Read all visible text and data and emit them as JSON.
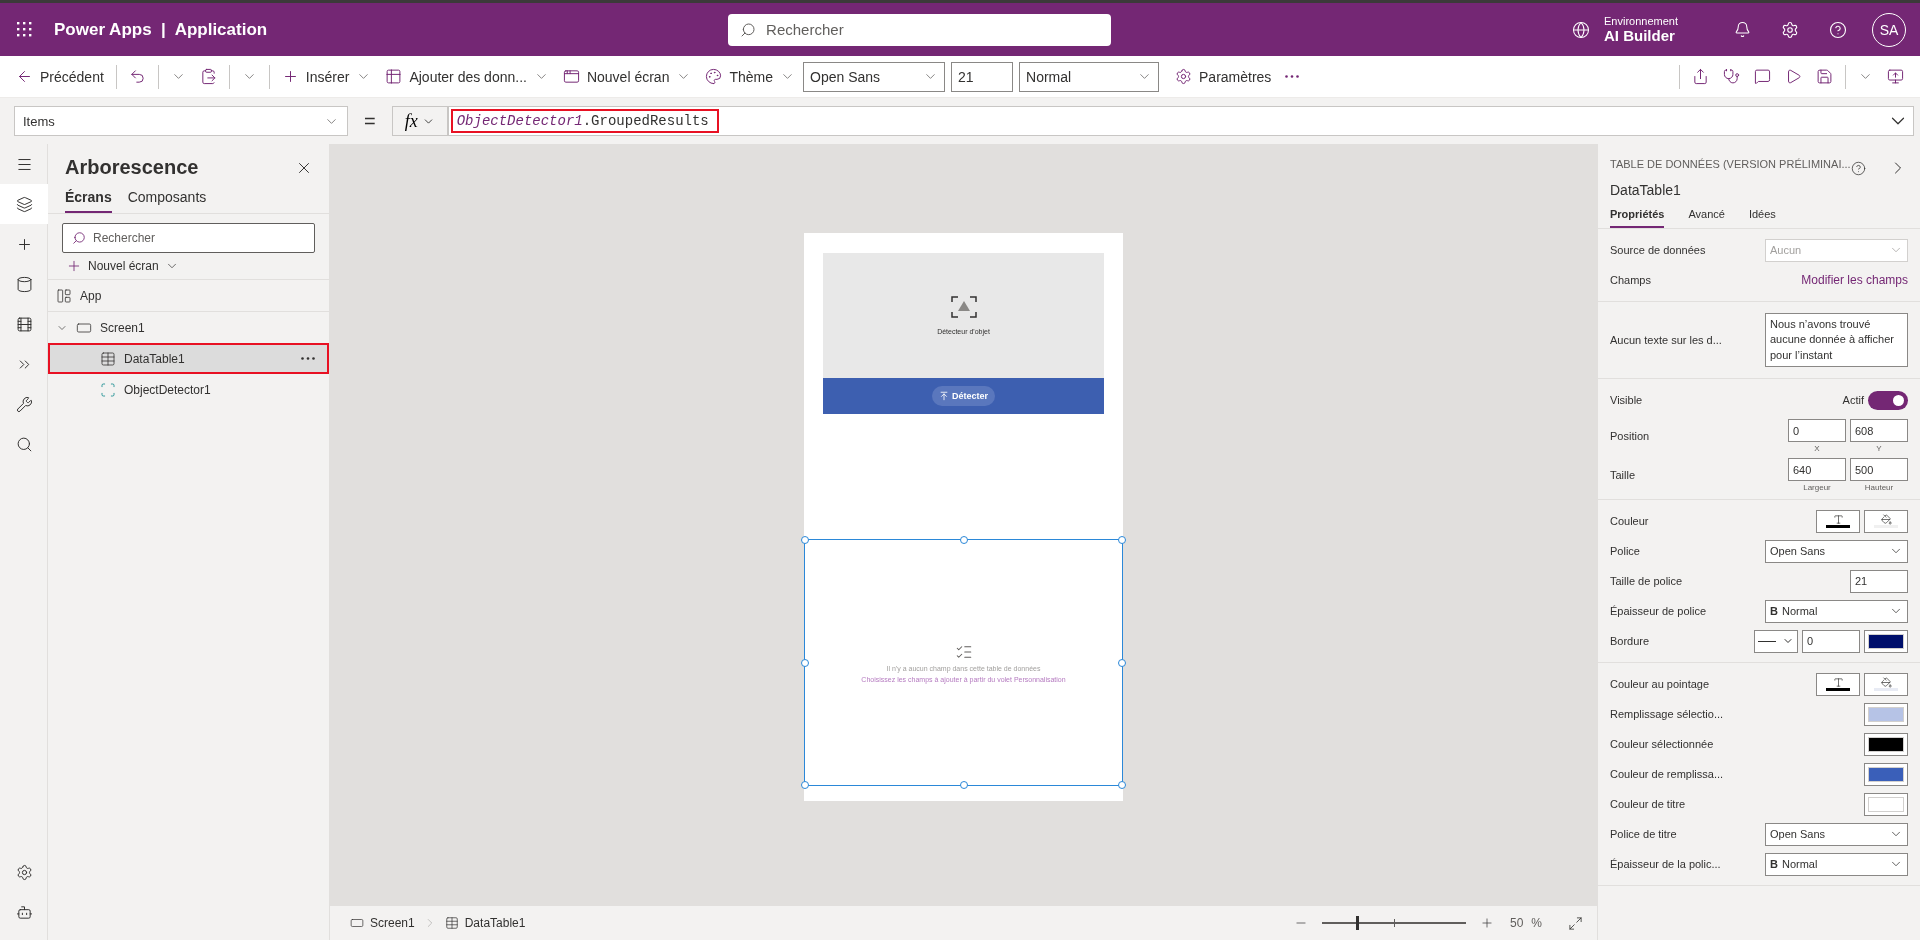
{
  "top_bar": {
    "title": "Power Apps  |  Application",
    "search": {
      "placeholder": "Rechercher"
    },
    "environment": {
      "label": "Environnement",
      "name": "AI Builder"
    },
    "avatar": "SA"
  },
  "toolbar": {
    "back": "Précédent",
    "insert": "Insérer",
    "add_data": "Ajouter des donn...",
    "new_screen": "Nouvel écran",
    "theme": "Thème",
    "font": "Open Sans",
    "font_size": "21",
    "font_weight": "Normal",
    "settings": "Paramètres"
  },
  "formula_bar": {
    "property": "Items",
    "equals": "=",
    "fx": "fx",
    "object": "ObjectDetector1",
    "member": ".GroupedResults",
    "highlighted": true
  },
  "rail": {
    "top": [
      {
        "kind": "menu",
        "selected": false
      },
      {
        "kind": "tree",
        "selected": true
      },
      {
        "kind": "insert",
        "selected": false
      },
      {
        "kind": "data",
        "selected": false
      },
      {
        "kind": "media",
        "selected": false
      },
      {
        "kind": "automate",
        "selected": false
      },
      {
        "kind": "tools",
        "selected": false
      },
      {
        "kind": "search",
        "selected": false
      }
    ],
    "bottom": [
      {
        "kind": "settings",
        "selected": false
      },
      {
        "kind": "bot",
        "selected": false
      }
    ]
  },
  "tree_panel": {
    "title": "Arborescence",
    "tabs": [
      {
        "label": "Écrans",
        "selected": true
      },
      {
        "label": "Composants",
        "selected": false
      }
    ],
    "search": {
      "placeholder": "Rechercher"
    },
    "new_screen": "Nouvel écran",
    "items": [
      {
        "kind": "app",
        "label": "App",
        "selected": false
      },
      {
        "kind": "screen",
        "label": "Screen1",
        "selected": false,
        "expanded": true,
        "children": [
          {
            "kind": "table",
            "label": "DataTable1",
            "selected": true,
            "highlighted": true
          },
          {
            "kind": "detector",
            "label": "ObjectDetector1",
            "selected": false,
            "highlighted": false
          }
        ]
      }
    ]
  },
  "canvas": {
    "detector": {
      "label": "Détecteur d'objet",
      "button": "Détecter"
    },
    "table": {
      "selected": true,
      "message": "Il n'y a aucun champ dans cette table de données",
      "hint": "Choisissez les champs à ajouter à partir du volet Personnalisation"
    }
  },
  "status_bar": {
    "breadcrumbs": [
      {
        "kind": "screen",
        "label": "Screen1"
      },
      {
        "kind": "table",
        "label": "DataTable1"
      }
    ],
    "zoom": {
      "level": 0.24,
      "value": "50",
      "unit": "%"
    }
  },
  "properties": {
    "type": "TABLE DE DONNÉES (VERSION PRÉLIMINAI...",
    "name": "DataTable1",
    "tabs": [
      {
        "label": "Propriétés",
        "selected": true
      },
      {
        "label": "Avancé",
        "selected": false
      },
      {
        "label": "Idées",
        "selected": false
      }
    ],
    "sections": [
      {
        "rows": [
          {
            "kind": "dropdown",
            "label": "Source de données",
            "value": "Aucun",
            "disabled": true
          },
          {
            "kind": "link",
            "label": "Champs",
            "link": "Modifier les champs"
          }
        ]
      },
      {
        "rows": [
          {
            "kind": "textarea",
            "label": "Aucun texte sur les d...",
            "value": "Nous n’avons trouvé aucune donnée à afficher pour l’instant"
          }
        ]
      },
      {
        "rows": [
          {
            "kind": "toggle",
            "label": "Visible",
            "state": "Actif",
            "on": true
          },
          {
            "kind": "pair",
            "label": "Position",
            "fields": [
              {
                "value": "0",
                "caption": "X"
              },
              {
                "value": "608",
                "caption": "Y"
              }
            ]
          },
          {
            "kind": "pair",
            "label": "Taille",
            "fields": [
              {
                "value": "640",
                "caption": "Largeur"
              },
              {
                "value": "500",
                "caption": "Hauteur"
              }
            ]
          }
        ]
      },
      {
        "rows": [
          {
            "kind": "swatches",
            "label": "Couleur",
            "swatches": [
              {
                "kind": "text",
                "color": "#000000"
              },
              {
                "kind": "fill",
                "color": "#f0f0f0"
              }
            ]
          },
          {
            "kind": "dropdown",
            "label": "Police",
            "value": "Open Sans",
            "disabled": false
          },
          {
            "kind": "number",
            "label": "Taille de police",
            "value": "21"
          },
          {
            "kind": "dropdown",
            "label": "Épaisseur de police",
            "prefix": "B",
            "value": "Normal",
            "disabled": false
          },
          {
            "kind": "border",
            "label": "Bordure",
            "value": "0",
            "color": "#000f6b"
          }
        ]
      },
      {
        "rows": [
          {
            "kind": "swatches",
            "label": "Couleur au pointage",
            "swatches": [
              {
                "kind": "text",
                "color": "#000000"
              },
              {
                "kind": "fill",
                "color": "#e8ebf4"
              }
            ]
          },
          {
            "kind": "swatch",
            "label": "Remplissage sélectio...",
            "color": "#b6c3e6"
          },
          {
            "kind": "swatch",
            "label": "Couleur sélectionnée",
            "color": "#000000"
          },
          {
            "kind": "swatch",
            "label": "Couleur de remplissa...",
            "color": "#3a5fb9"
          },
          {
            "kind": "swatch",
            "label": "Couleur de titre",
            "color": "#ffffff"
          },
          {
            "kind": "dropdown",
            "label": "Police de titre",
            "value": "Open Sans",
            "disabled": false
          },
          {
            "kind": "dropdown",
            "label": "Épaisseur de la polic...",
            "prefix": "B",
            "value": "Normal",
            "disabled": false
          }
        ]
      }
    ]
  }
}
